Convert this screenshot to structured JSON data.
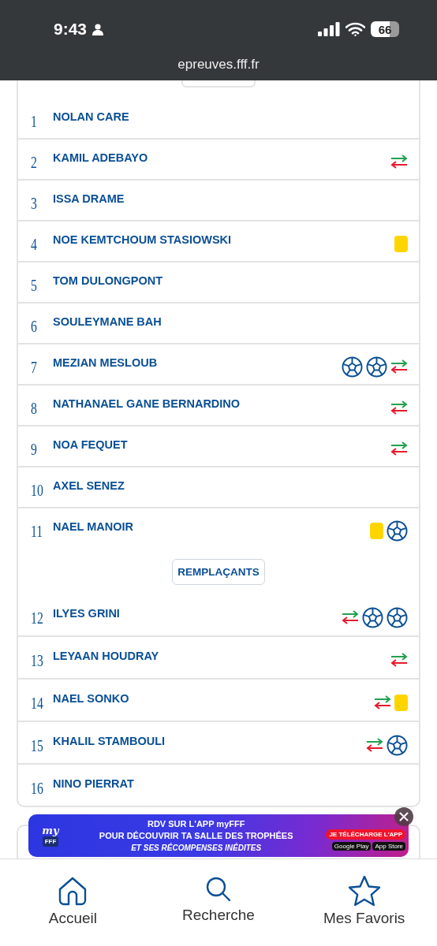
{
  "status_bar": {
    "time": "9:43",
    "battery": "66"
  },
  "browser": {
    "url": "epreuves.fff.fr"
  },
  "starters": [
    {
      "number": "1",
      "name": "NOLAN CARE"
    },
    {
      "number": "2",
      "name": "KAMIL ADEBAYO",
      "events": [
        {
          "kind": "sub"
        }
      ]
    },
    {
      "number": "3",
      "name": "ISSA DRAME"
    },
    {
      "number": "4",
      "name": "NOE KEMTCHOUM STASIOWSKI",
      "events": [
        {
          "kind": "yellow"
        }
      ]
    },
    {
      "number": "5",
      "name": "TOM DULONGPONT"
    },
    {
      "number": "6",
      "name": "SOULEYMANE BAH"
    },
    {
      "number": "7",
      "name": "MEZIAN MESLOUB",
      "events": [
        {
          "kind": "goal"
        },
        {
          "kind": "goal"
        },
        {
          "kind": "sub"
        }
      ]
    },
    {
      "number": "8",
      "name": "NATHANAEL GANE BERNARDINO",
      "events": [
        {
          "kind": "sub"
        }
      ]
    },
    {
      "number": "9",
      "name": "NOA FEQUET",
      "events": [
        {
          "kind": "sub"
        }
      ]
    },
    {
      "number": "10",
      "name": "AXEL SENEZ"
    },
    {
      "number": "11",
      "name": "NAEL MANOIR",
      "events": [
        {
          "kind": "yellow"
        },
        {
          "kind": "goal"
        }
      ]
    }
  ],
  "substitutes_heading": "REMPLAÇANTS",
  "substitutes": [
    {
      "number": "12",
      "name": "ILYES GRINI",
      "events": [
        {
          "kind": "sub"
        },
        {
          "kind": "goal"
        },
        {
          "kind": "goal"
        }
      ]
    },
    {
      "number": "13",
      "name": "LEYAAN HOUDRAY",
      "events": [
        {
          "kind": "sub"
        }
      ]
    },
    {
      "number": "14",
      "name": "NAEL SONKO",
      "events": [
        {
          "kind": "sub"
        },
        {
          "kind": "yellow"
        }
      ]
    },
    {
      "number": "15",
      "name": "KHALIL STAMBOULI",
      "events": [
        {
          "kind": "sub"
        },
        {
          "kind": "goal"
        }
      ]
    },
    {
      "number": "16",
      "name": "NINO PIERRAT"
    }
  ],
  "banner": {
    "logo": "my",
    "logo_badge": "FFF",
    "line_1": "RDV SUR L'APP myFFF",
    "line_2": "POUR DÉCOUVRIR TA SALLE DES TROPHÉES",
    "line_3": "ET SES RÉCOMPENSES INÉDITES",
    "cta": "JE TÉLÉCHARGE L'APP",
    "store_1": "Google Play",
    "store_2": "App Store"
  },
  "bottom_nav": [
    {
      "kind": "home",
      "label": "Accueil"
    },
    {
      "kind": "search",
      "label": "Recherche"
    },
    {
      "kind": "star",
      "label": "Mes Favoris"
    }
  ]
}
